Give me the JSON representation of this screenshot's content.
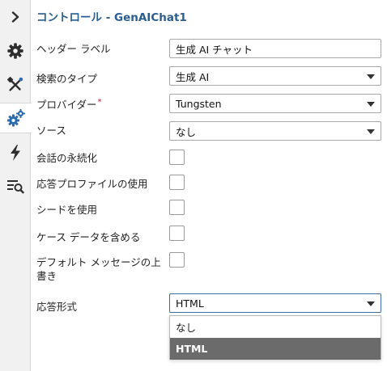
{
  "sidebar": {
    "items": [
      {
        "icon": "chevron-right-icon"
      },
      {
        "icon": "gear-icon"
      },
      {
        "icon": "tools-icon"
      },
      {
        "icon": "gears-icon",
        "active": true
      },
      {
        "icon": "lightning-icon"
      },
      {
        "icon": "search-list-icon"
      }
    ]
  },
  "panel": {
    "title": "コントロール - GenAIChat1"
  },
  "fields": {
    "header_label": {
      "label": "ヘッダー ラベル",
      "value": "生成 AI チャット"
    },
    "search_type": {
      "label": "検索のタイプ",
      "value": "生成 AI"
    },
    "provider": {
      "label": "プロバイダー",
      "required_mark": "*",
      "value": "Tungsten"
    },
    "source": {
      "label": "ソース",
      "value": "なし"
    },
    "persist_conversation": {
      "label": "会話の永続化",
      "checked": false
    },
    "use_response_profile": {
      "label": "応答プロファイルの使用",
      "checked": false
    },
    "use_seed": {
      "label": "シードを使用",
      "checked": false
    },
    "include_case_data": {
      "label": "ケース データを含める",
      "checked": false
    },
    "override_default_message": {
      "label": "デフォルト メッセージの上書き",
      "checked": false
    },
    "response_format": {
      "label": "応答形式",
      "value": "HTML",
      "options": [
        "なし",
        "HTML"
      ],
      "selected_index": 1
    }
  },
  "colors": {
    "title": "#2b5d8f",
    "icon_blue": "#2b6cb0",
    "icon_dark": "#2d2d2d",
    "selected_option_bg": "#6b6b6b",
    "required": "#c8102e"
  }
}
